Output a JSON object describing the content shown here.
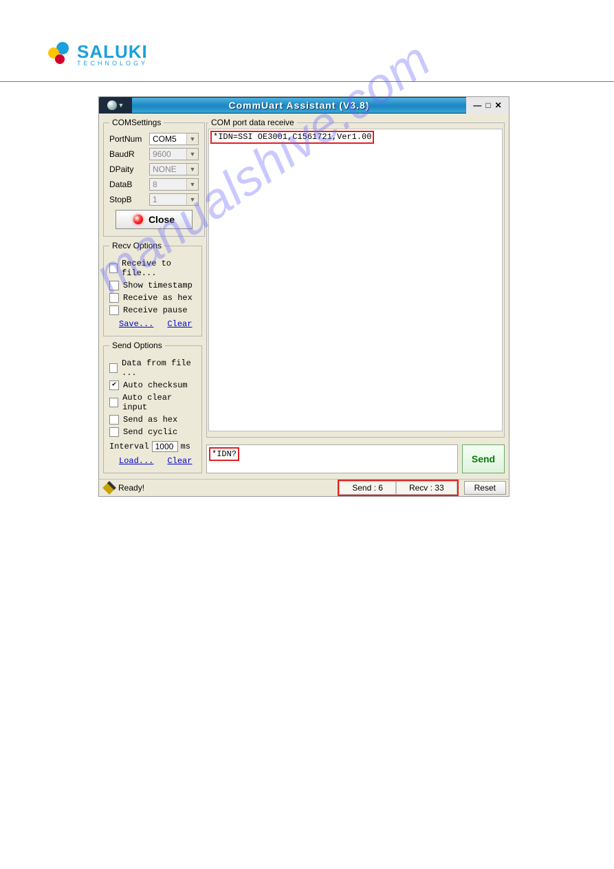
{
  "doc": {
    "brand": "SALUKI",
    "brand_sub": "TECHNOLOGY",
    "watermark": "manualshive.com"
  },
  "app": {
    "title": "CommUart Assistant (V3.8)"
  },
  "com": {
    "legend": "COMSettings",
    "portnum_label": "PortNum",
    "portnum": "COM5",
    "baud_label": "BaudR",
    "baud": "9600",
    "parity_label": "DPaity",
    "parity": "NONE",
    "databits_label": "DataB",
    "databits": "8",
    "stopbits_label": "StopB",
    "stopbits": "1",
    "close_label": "Close"
  },
  "recv": {
    "legend": "Recv Options",
    "items": [
      "Receive to file...",
      "Show timestamp",
      "Receive as hex",
      "Receive pause"
    ],
    "save": "Save...",
    "clear": "Clear"
  },
  "send": {
    "legend": "Send Options",
    "items": [
      "Data from file ...",
      "Auto checksum",
      "Auto clear input",
      "Send as hex",
      "Send cyclic"
    ],
    "interval_label": "Interval",
    "interval": "1000",
    "interval_unit": "ms",
    "load": "Load...",
    "clear": "Clear"
  },
  "receive": {
    "legend": "COM port data receive",
    "lines": [
      "*IDN=SSI OE3001,C1561721,Ver1.00"
    ]
  },
  "sendbox": {
    "value": "*IDN?",
    "button": "Send"
  },
  "status": {
    "ready": "Ready!",
    "send": "Send : 6",
    "recv": "Recv : 33",
    "reset": "Reset"
  }
}
